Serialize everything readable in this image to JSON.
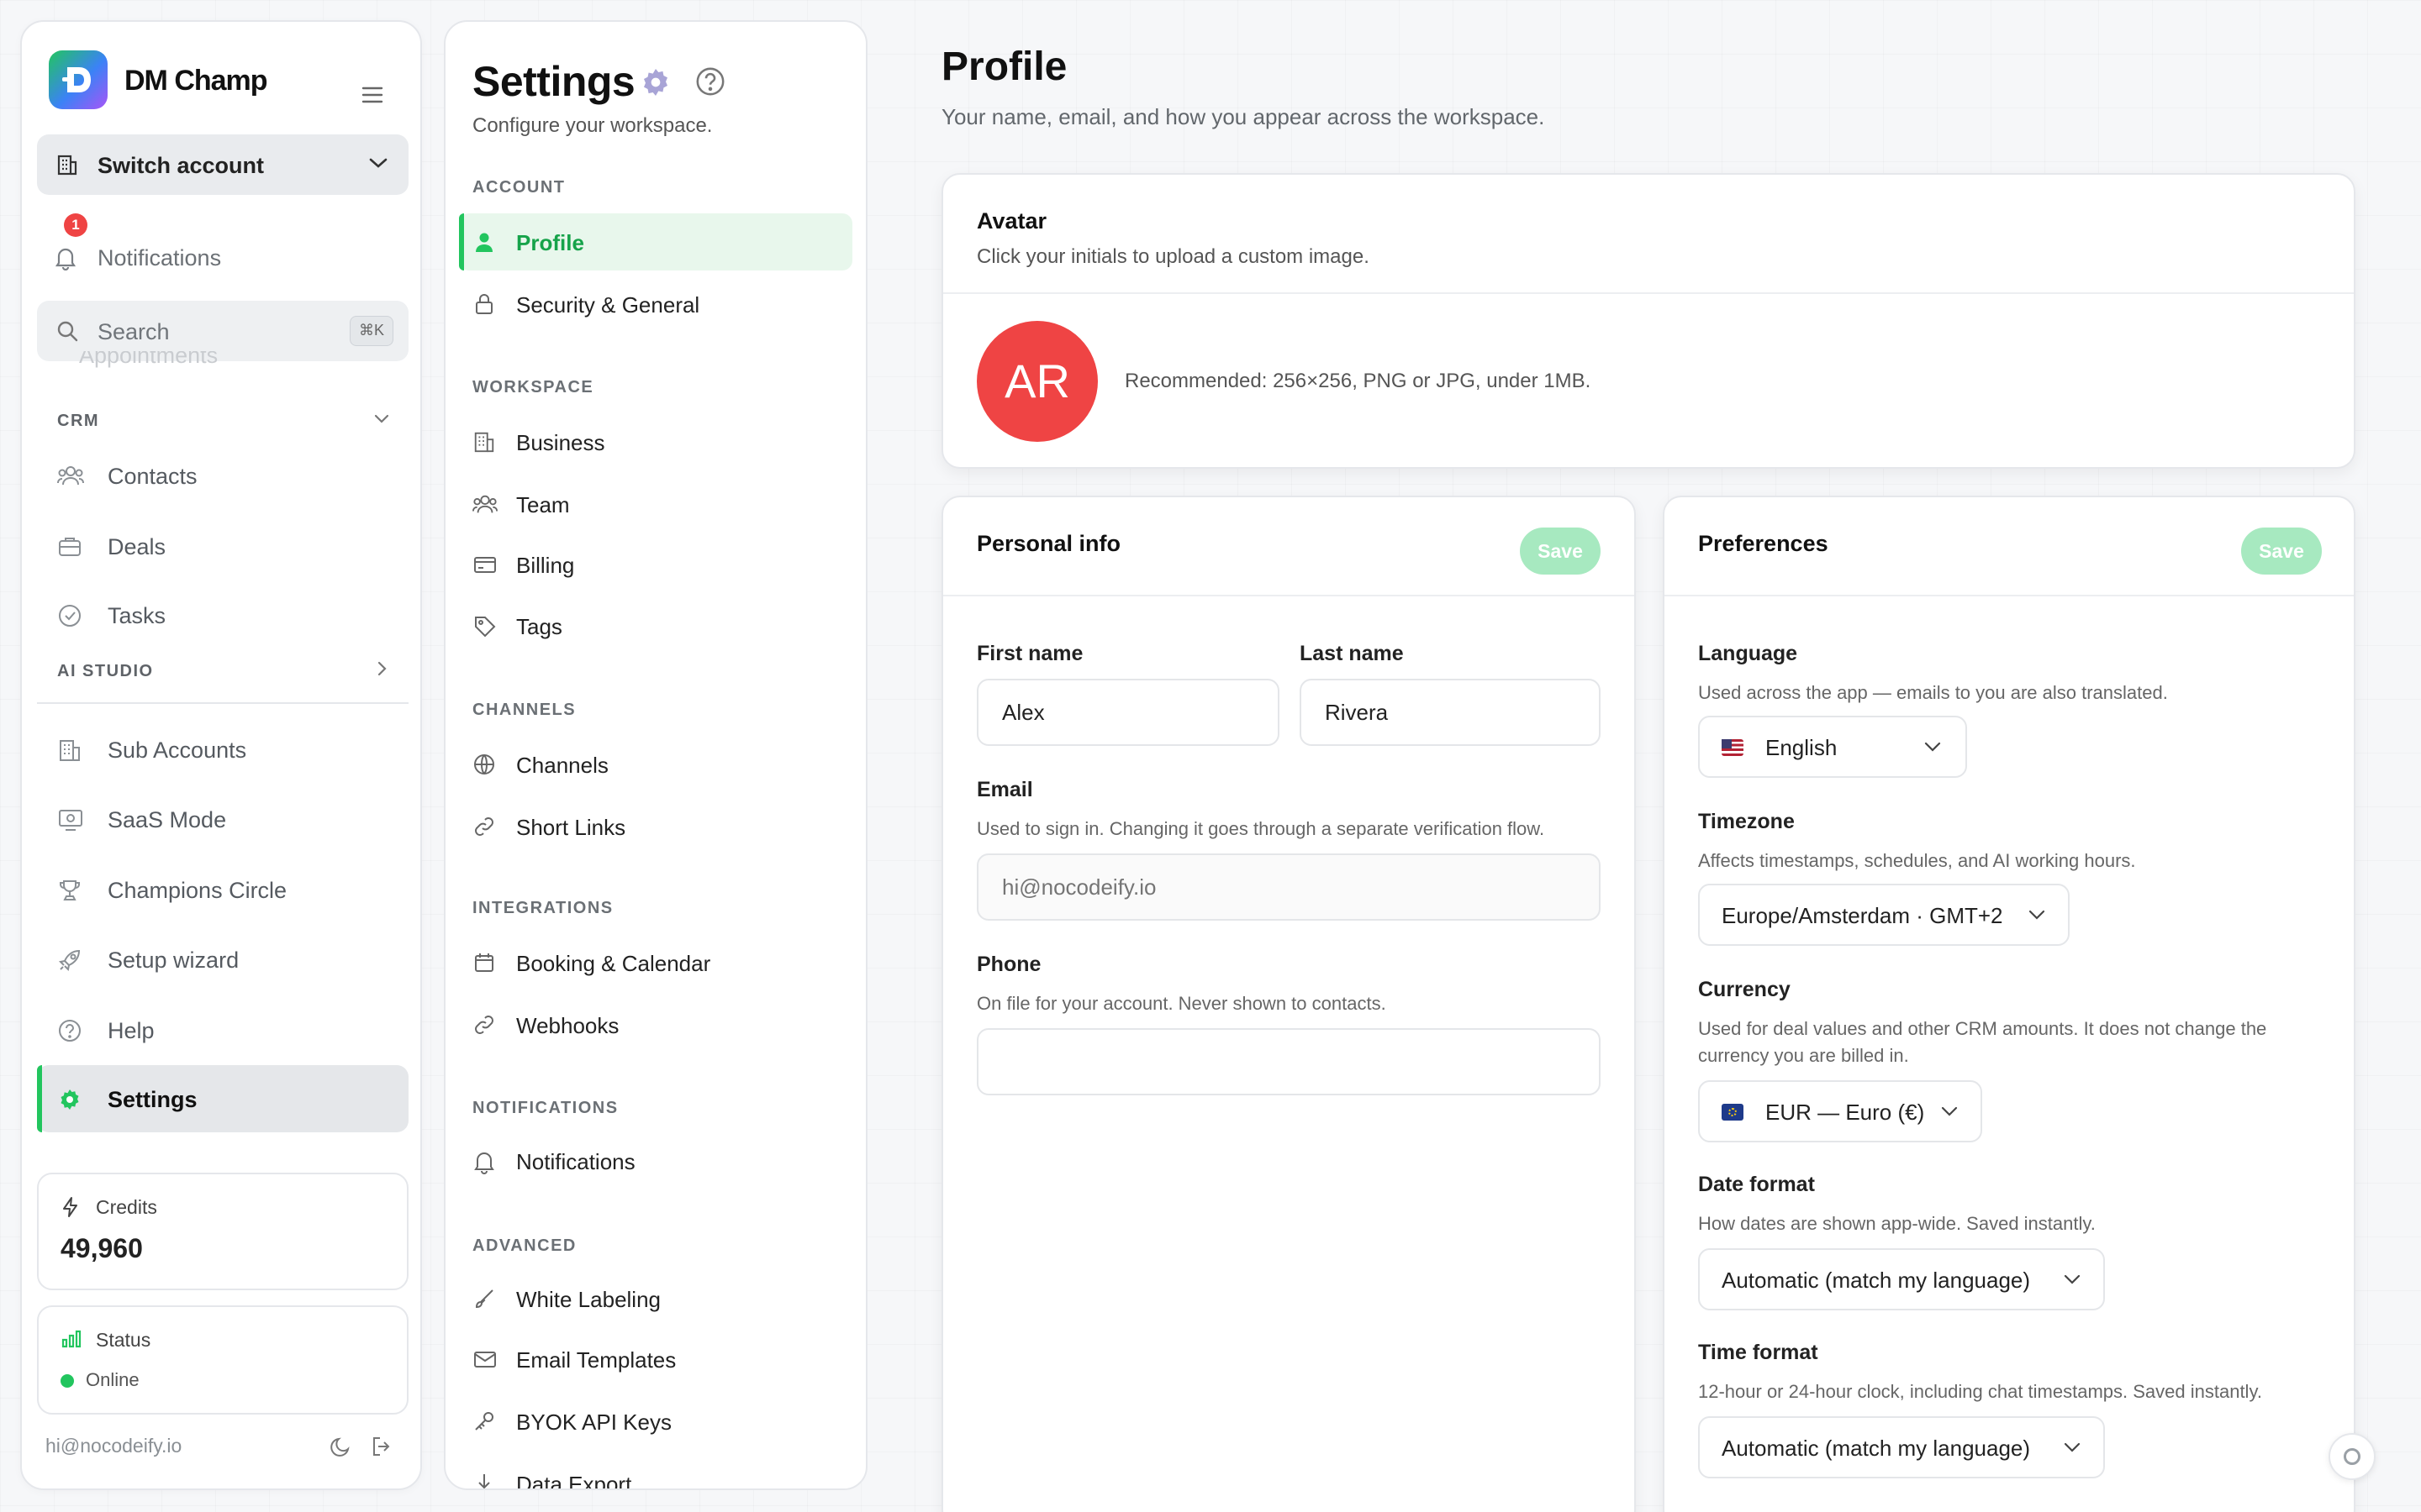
{
  "brand": {
    "name": "DM Champ"
  },
  "sidebar": {
    "switch_account": "Switch account",
    "notifications": {
      "label": "Notifications",
      "badge": "1"
    },
    "search": {
      "label": "Search",
      "shortcut": "⌘K"
    },
    "faded_item": "Appointments",
    "crm_section": "CRM",
    "crm_items": [
      {
        "label": "Contacts",
        "icon": "users-icon"
      },
      {
        "label": "Deals",
        "icon": "briefcase-icon"
      },
      {
        "label": "Tasks",
        "icon": "check-circle-icon"
      }
    ],
    "ai_section": "AI STUDIO",
    "bottom_items": [
      {
        "label": "Sub Accounts",
        "icon": "building-icon"
      },
      {
        "label": "SaaS Mode",
        "icon": "monitor-icon"
      },
      {
        "label": "Champions Circle",
        "icon": "trophy-icon"
      },
      {
        "label": "Setup wizard",
        "icon": "rocket-icon"
      },
      {
        "label": "Help",
        "icon": "help-icon"
      },
      {
        "label": "Settings",
        "icon": "gear-icon"
      }
    ],
    "credits": {
      "label": "Credits",
      "value": "49,960"
    },
    "status": {
      "label": "Status",
      "value": "Online"
    },
    "footer_email": "hi@nocodeify.io"
  },
  "settings_nav": {
    "title": "Settings",
    "subtitle": "Configure your workspace.",
    "sections": [
      {
        "title": "ACCOUNT",
        "items": [
          "Profile",
          "Security & General"
        ]
      },
      {
        "title": "WORKSPACE",
        "items": [
          "Business",
          "Team",
          "Billing",
          "Tags"
        ]
      },
      {
        "title": "CHANNELS",
        "items": [
          "Channels",
          "Short Links"
        ]
      },
      {
        "title": "INTEGRATIONS",
        "items": [
          "Booking & Calendar",
          "Webhooks"
        ]
      },
      {
        "title": "NOTIFICATIONS",
        "items": [
          "Notifications"
        ]
      },
      {
        "title": "ADVANCED",
        "items": [
          "White Labeling",
          "Email Templates",
          "BYOK API Keys",
          "Data Export"
        ]
      }
    ]
  },
  "profile": {
    "title": "Profile",
    "subtitle": "Your name, email, and how you appear across the workspace.",
    "avatar": {
      "title": "Avatar",
      "desc": "Click your initials to upload a custom image.",
      "initials": "AR",
      "recommendation": "Recommended: 256×256, PNG or JPG, under 1MB."
    },
    "personal": {
      "title": "Personal info",
      "save": "Save",
      "first_name_label": "First name",
      "first_name": "Alex",
      "last_name_label": "Last name",
      "last_name": "Rivera",
      "email_label": "Email",
      "email_help": "Used to sign in. Changing it goes through a separate verification flow.",
      "email_placeholder": "hi@nocodeify.io",
      "phone_label": "Phone",
      "phone_help": "On file for your account. Never shown to contacts.",
      "phone": ""
    },
    "preferences": {
      "title": "Preferences",
      "save": "Save",
      "language_label": "Language",
      "language_help": "Used across the app — emails to you are also translated.",
      "language": "English",
      "timezone_label": "Timezone",
      "timezone_help": "Affects timestamps, schedules, and AI working hours.",
      "timezone": "Europe/Amsterdam · GMT+2",
      "currency_label": "Currency",
      "currency_help_1": "Used for deal values and other CRM amounts. It does not change the",
      "currency_help_2": "currency you are billed in.",
      "currency": "EUR — Euro (€)",
      "date_label": "Date format",
      "date_help": "How dates are shown app-wide. Saved instantly.",
      "date": "Automatic (match my language)",
      "time_label": "Time format",
      "time_help": "12-hour or 24-hour clock, including chat timestamps. Saved instantly.",
      "time": "Automatic (match my language)"
    }
  },
  "colors": {
    "accent": "#22c55e",
    "avatar": "#ef4444",
    "badge": "#ef4444"
  }
}
